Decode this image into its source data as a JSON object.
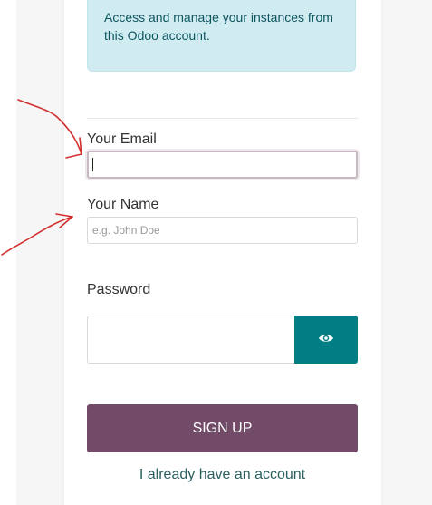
{
  "info": {
    "text": "Access and manage your instances from this Odoo account."
  },
  "form": {
    "email_label": "Your Email",
    "email_value": "",
    "name_label": "Your Name",
    "name_placeholder": "e.g. John Doe",
    "password_label": "Password",
    "password_value": ""
  },
  "actions": {
    "signup_label": "SIGN UP",
    "login_link": "I already have an account"
  },
  "icons": {
    "password_toggle": "eye-icon"
  },
  "colors": {
    "primary": "#714b67",
    "teal": "#017e84",
    "info_bg": "#d1ecf1",
    "info_text": "#0c5460",
    "annotation": "#d32f2f"
  }
}
